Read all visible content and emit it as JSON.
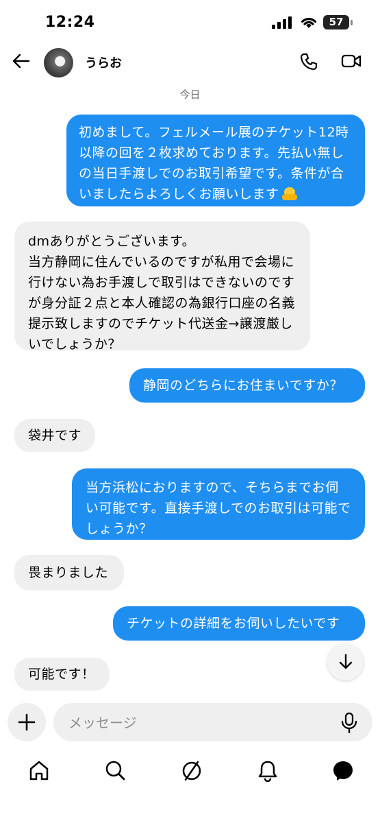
{
  "status_bar": {
    "time": "12:24",
    "battery": "57"
  },
  "header": {
    "contact_name": "うらお"
  },
  "date_label": "今日",
  "messages": [
    {
      "direction": "outgoing",
      "text": "初めまして。フェルメール展のチケット12時以降の回を２枚求めております。先払い無しの当日手渡しでのお取引希望です。条件が合いましたらよろしくお願いします",
      "emoji": "folded-hands-emoji"
    },
    {
      "direction": "incoming",
      "lines": [
        "dmありがとうございます。",
        "当方静岡に住んでいるのですが私用で会場に行けない為お手渡しで取引はできないのですが身分証２点と本人確認の為銀行口座の名義提示致しますのでチケット代送金→譲渡厳しいでしょうか？"
      ]
    },
    {
      "direction": "outgoing",
      "text": "静岡のどちらにお住まいですか？"
    },
    {
      "direction": "incoming",
      "text": "袋井です"
    },
    {
      "direction": "outgoing",
      "text": "当方浜松におりますので、そちらまでお伺い可能です。直接手渡しでのお取引は可能でしょうか？"
    },
    {
      "direction": "incoming",
      "text": "畏まりました"
    },
    {
      "direction": "outgoing",
      "text": "チケットの詳細をお伺いしたいです"
    },
    {
      "direction": "incoming",
      "text": "可能です！"
    }
  ],
  "composer": {
    "placeholder": "メッセージ"
  },
  "colors": {
    "outgoing_bubble": "#1f8ef1",
    "incoming_bubble": "#efefef"
  },
  "icons": [
    "back-arrow-icon",
    "phone-icon",
    "video-camera-icon",
    "arrow-down-icon",
    "plus-icon",
    "microphone-icon",
    "home-icon",
    "search-icon",
    "explore-icon",
    "bell-icon",
    "messenger-icon"
  ]
}
